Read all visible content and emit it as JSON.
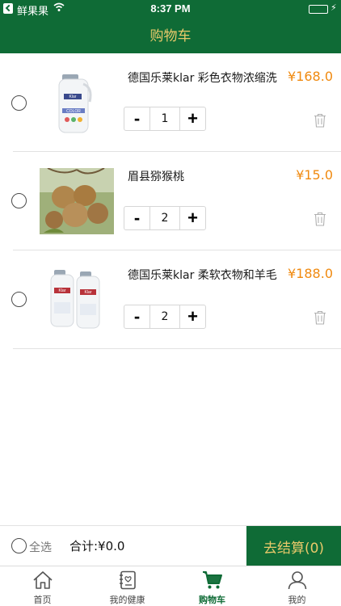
{
  "status_bar": {
    "carrier": "鲜果果",
    "time": "8:37 PM"
  },
  "nav": {
    "title": "购物车"
  },
  "cart_items": [
    {
      "name": "德国乐莱klar 彩色衣物浓缩洗",
      "price": "¥168.0",
      "quantity": "1",
      "image": "detergent-bottle"
    },
    {
      "name": "眉县猕猴桃",
      "price": "¥15.0",
      "quantity": "2",
      "image": "kiwi-fruit"
    },
    {
      "name": "德国乐莱klar 柔软衣物和羊毛",
      "price": "¥188.0",
      "quantity": "2",
      "image": "two-detergent-bottles"
    }
  ],
  "stepper": {
    "minus": "-",
    "plus": "+"
  },
  "footer": {
    "select_all": "全选",
    "total": "合计:¥0.0",
    "checkout": "去结算(0)"
  },
  "tabs": [
    {
      "label": "首页",
      "icon": "home-icon"
    },
    {
      "label": "我的健康",
      "icon": "health-book-icon"
    },
    {
      "label": "购物车",
      "icon": "cart-icon",
      "active": true
    },
    {
      "label": "我的",
      "icon": "user-icon"
    }
  ],
  "colors": {
    "brand_green": "#0f6b36",
    "title_gold": "#e9c96a",
    "price_orange": "#f08a10"
  }
}
